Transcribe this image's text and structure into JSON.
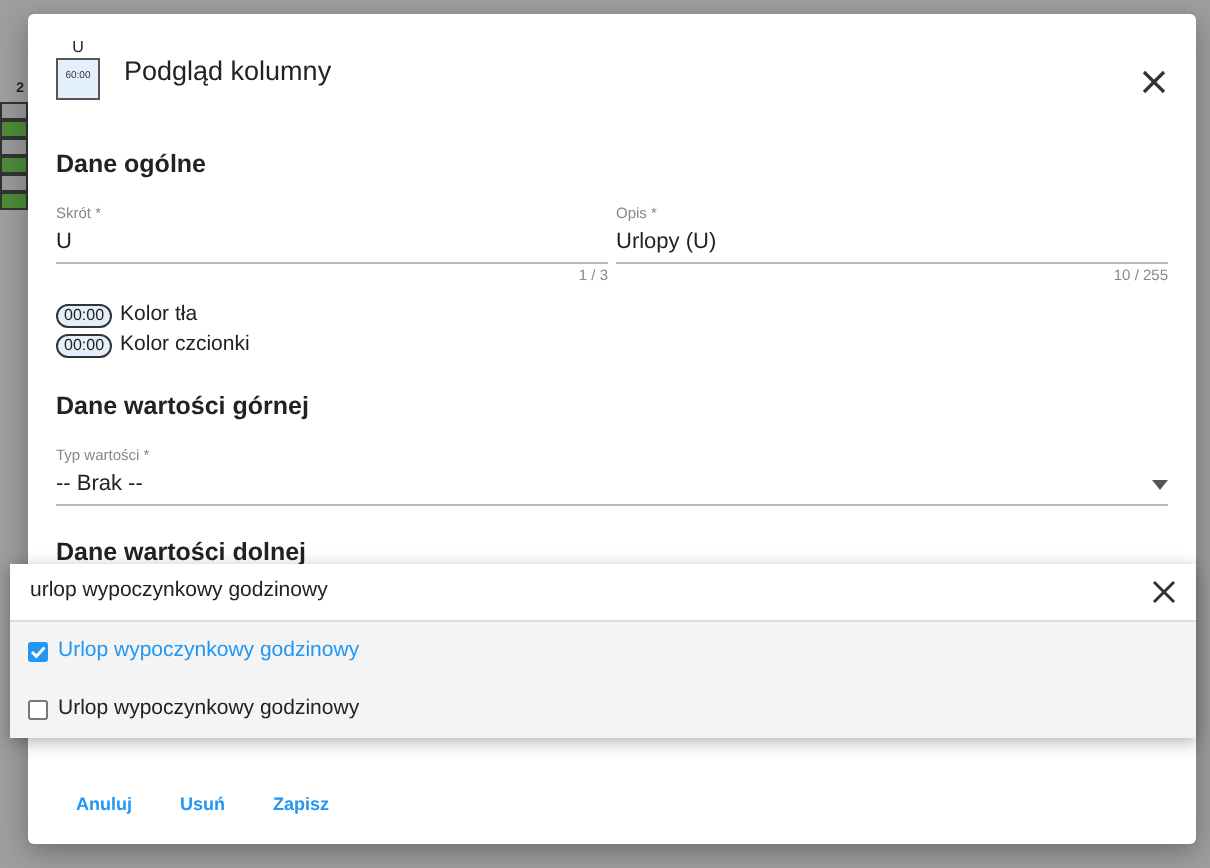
{
  "background": {
    "column_header": "2"
  },
  "dialog": {
    "icon_label": "U",
    "icon_time": "60:00",
    "title": "Podgląd kolumny",
    "sections": [
      {
        "title": "Dane ogólne",
        "fields": [
          {
            "label": "Skrót *",
            "value": "U",
            "counter": "1 / 3"
          },
          {
            "label": "Opis *",
            "value": "Urlopy (U)",
            "counter": "10 / 255"
          }
        ],
        "colors": [
          {
            "chip": "00:00",
            "label": "Kolor tła"
          },
          {
            "chip": "00:00",
            "label": "Kolor czcionki"
          }
        ]
      },
      {
        "title": "Dane wartości górnej",
        "select": {
          "label": "Typ wartości *",
          "value": "-- Brak --"
        }
      },
      {
        "title": "Dane wartości dolnej"
      }
    ],
    "buttons": [
      "Anuluj",
      "Usuń",
      "Zapisz"
    ]
  },
  "dropdown": {
    "search": "urlop wypoczynkowy godzinowy",
    "options": [
      {
        "label": "Urlop wypoczynkowy godzinowy",
        "checked": true
      },
      {
        "label": "Urlop wypoczynkowy godzinowy",
        "checked": false
      }
    ]
  }
}
